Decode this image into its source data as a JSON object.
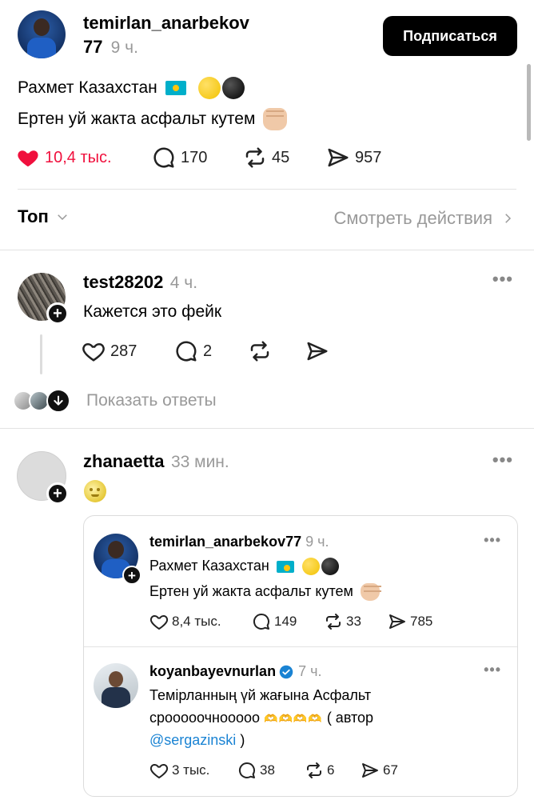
{
  "post": {
    "username": "temirlan_anarbekov",
    "username_suffix": "77",
    "time": "9 ч.",
    "follow_label": "Подписаться",
    "line1": "Рахмет Казахстан",
    "line2": "Ертен уй жакта асфальт кутем",
    "likes": "10,4 тыс.",
    "comments": "170",
    "reposts": "45",
    "shares": "957"
  },
  "sort": {
    "label": "Топ",
    "activity_label": "Смотреть действия"
  },
  "comments": [
    {
      "username": "test28202",
      "time": "4 ч.",
      "text": "Кажется это фейк",
      "likes": "287",
      "replies": "2",
      "show_replies": "Показать ответы"
    },
    {
      "username": "zhanaetta",
      "time": "33 мин.",
      "quote": {
        "username": "temirlan_anarbekov77",
        "time": "9 ч.",
        "line1": "Рахмет Казахстан",
        "line2": "Ертен уй жакта асфальт кутем",
        "likes": "8,4 тыс.",
        "comments": "149",
        "reposts": "33",
        "shares": "785"
      },
      "nested": {
        "username": "koyanbayevnurlan",
        "time": "7 ч.",
        "line1": "Темірланның үй жағына Асфальт",
        "line2_prefix": "срооооочнооооо",
        "line2_suffix": "( автор",
        "mention": "@sergazinski",
        "line3_suffix": ")",
        "likes": "3 тыс.",
        "comments": "38",
        "reposts": "6",
        "shares": "67"
      }
    }
  ],
  "colors": {
    "like_red": "#f0103d",
    "link_blue": "#1a83d3",
    "verified": "#1a83d3"
  }
}
